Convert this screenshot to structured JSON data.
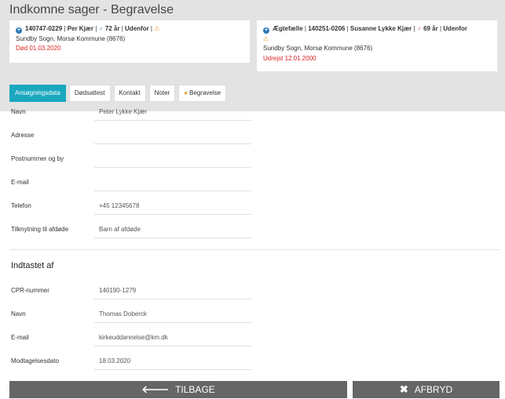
{
  "page": {
    "title": "Indkomne sager - Begravelse"
  },
  "cards": {
    "deceased": {
      "line1": {
        "cpr": "140747-0229",
        "name": "Per Kjær",
        "age": "72 år",
        "status": "Udenfor"
      },
      "line2": "Sundby Sogn, Morsø Kommune (8676)",
      "line3": "Død 01.03.2020"
    },
    "spouse": {
      "line1": {
        "relation": "Ægtefælle",
        "cpr": "140251-0206",
        "name": "Susanne Lykke Kjær",
        "age": "69 år",
        "status": "Udenfor"
      },
      "line2": "Sundby Sogn, Morsø Kommune (8676)",
      "line3": "Udrejst 12.01.2000"
    }
  },
  "tabs": [
    {
      "label": "Ansøgningsdata"
    },
    {
      "label": "Dødsattest"
    },
    {
      "label": "Kontakt"
    },
    {
      "label": "Noter"
    },
    {
      "label": "Begravelse"
    }
  ],
  "applicant": {
    "name": {
      "label": "Navn",
      "value": "Peter Lykke Kjær"
    },
    "address": {
      "label": "Adresse",
      "value": ""
    },
    "postal": {
      "label": "Postnummer og by",
      "value": ""
    },
    "email": {
      "label": "E-mail",
      "value": ""
    },
    "phone": {
      "label": "Telefon",
      "value": "+45 12345678"
    },
    "relation": {
      "label": "Tilknytning til afdøde",
      "value": "Barn af afdøde"
    }
  },
  "entered_by": {
    "title": "Indtastet af",
    "cpr": {
      "label": "CPR-nummer",
      "value": "140190-1279"
    },
    "name": {
      "label": "Navn",
      "value": "Thomas Doberck"
    },
    "email": {
      "label": "E-mail",
      "value": "kirkeuddannelse@km.dk"
    },
    "received": {
      "label": "Modtagelsesdato",
      "value": "18.03.2020"
    }
  },
  "footer": {
    "back_label": "TILBAGE",
    "cancel_label": "AFBRYD"
  },
  "colors": {
    "accent": "#1aa8bf",
    "header_bg": "#e3e3e3",
    "button_bg": "#666666",
    "alert": "#e02020",
    "warning": "#f0a030"
  }
}
